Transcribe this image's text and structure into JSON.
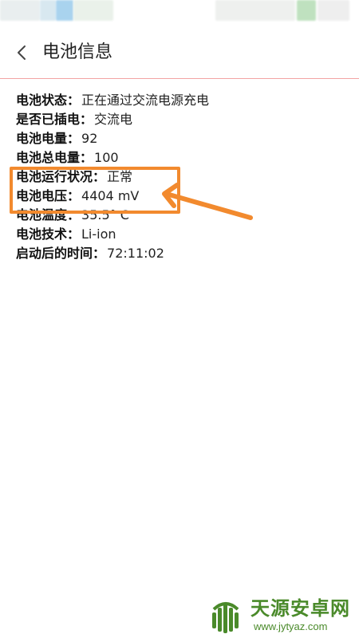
{
  "header": {
    "title": "电池信息"
  },
  "battery_info": [
    {
      "label": "电池状态：",
      "value": "正在通过交流电源充电"
    },
    {
      "label": "是否已插电：",
      "value": "交流电"
    },
    {
      "label": "电池电量：",
      "value": "92"
    },
    {
      "label": "电池总电量：",
      "value": "100"
    },
    {
      "label": "电池运行状况：",
      "value": "正常"
    },
    {
      "label": "电池电压：",
      "value": "4404 mV"
    },
    {
      "label": "电池温度：",
      "value": "35.5° C"
    },
    {
      "label": "电池技术：",
      "value": "Li-ion"
    },
    {
      "label": "启动后的时间：",
      "value": "72:11:02"
    }
  ],
  "annotation": {
    "highlight_color": "#f28a2e"
  },
  "watermark": {
    "name": "天源安卓网",
    "url": "www.jytyaz.com"
  }
}
